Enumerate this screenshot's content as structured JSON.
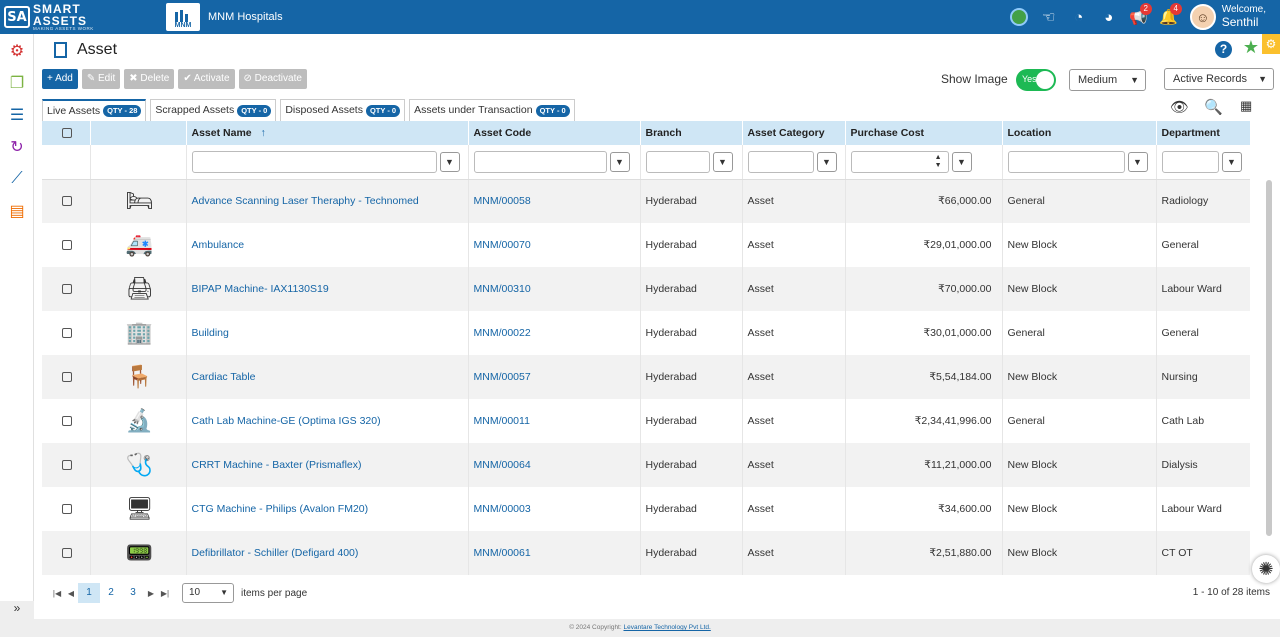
{
  "brand": {
    "logo_mark": "SA",
    "line1": "SMART",
    "line2": "ASSETS",
    "tagline": "MAKING ASSETS WORK",
    "client_logo": "MNM",
    "client_name": "MNM Hospitals"
  },
  "topbar": {
    "icons": [
      "globe-icon",
      "hand-icon",
      "pie-icon",
      "dashboard-icon",
      "megaphone-icon",
      "bell-icon"
    ],
    "megaphone_badge": "2",
    "bell_badge": "4",
    "welcome": "Welcome,",
    "user": "Senthil"
  },
  "page": {
    "title": "Asset"
  },
  "toolbar": {
    "add": "+ Add",
    "edit": "✎ Edit",
    "delete": "✖ Delete",
    "activate": "✔ Activate",
    "deactivate": "⊘ Deactivate"
  },
  "show_image": {
    "label": "Show Image",
    "toggle": "Yes"
  },
  "size_select": "Medium",
  "records_select": "Active Records",
  "tabs": [
    {
      "label": "Live Assets",
      "qty": "QTY - 28"
    },
    {
      "label": "Scrapped Assets",
      "qty": "QTY - 0"
    },
    {
      "label": "Disposed Assets",
      "qty": "QTY - 0"
    },
    {
      "label": "Assets under Transaction",
      "qty": "QTY - 0"
    }
  ],
  "columns": {
    "name": "Asset Name",
    "code": "Asset Code",
    "branch": "Branch",
    "category": "Asset Category",
    "cost": "Purchase Cost",
    "location": "Location",
    "department": "Department",
    "sort": "↑"
  },
  "rows": [
    {
      "name": "Advance Scanning Laser Theraphy - Technomed",
      "code": "MNM/00058",
      "branch": "Hyderabad",
      "category": "Asset",
      "cost": "₹66,000.00",
      "location": "General",
      "department": "Radiology"
    },
    {
      "name": "Ambulance",
      "code": "MNM/00070",
      "branch": "Hyderabad",
      "category": "Asset",
      "cost": "₹29,01,000.00",
      "location": "New Block",
      "department": "General"
    },
    {
      "name": "BIPAP Machine- IAX1130S19",
      "code": "MNM/00310",
      "branch": "Hyderabad",
      "category": "Asset",
      "cost": "₹70,000.00",
      "location": "New Block",
      "department": "Labour Ward"
    },
    {
      "name": "Building",
      "code": "MNM/00022",
      "branch": "Hyderabad",
      "category": "Asset",
      "cost": "₹30,01,000.00",
      "location": "General",
      "department": "General"
    },
    {
      "name": "Cardiac Table",
      "code": "MNM/00057",
      "branch": "Hyderabad",
      "category": "Asset",
      "cost": "₹5,54,184.00",
      "location": "New Block",
      "department": "Nursing"
    },
    {
      "name": "Cath Lab Machine-GE (Optima IGS 320)",
      "code": "MNM/00011",
      "branch": "Hyderabad",
      "category": "Asset",
      "cost": "₹2,34,41,996.00",
      "location": "General",
      "department": "Cath Lab"
    },
    {
      "name": "CRRT Machine - Baxter (Prismaflex)",
      "code": "MNM/00064",
      "branch": "Hyderabad",
      "category": "Asset",
      "cost": "₹11,21,000.00",
      "location": "New Block",
      "department": "Dialysis"
    },
    {
      "name": "CTG Machine - Philips (Avalon FM20)",
      "code": "MNM/00003",
      "branch": "Hyderabad",
      "category": "Asset",
      "cost": "₹34,600.00",
      "location": "New Block",
      "department": "Labour Ward"
    },
    {
      "name": "Defibrillator - Schiller (Defigard 400)",
      "code": "MNM/00061",
      "branch": "Hyderabad",
      "category": "Asset",
      "cost": "₹2,51,880.00",
      "location": "New Block",
      "department": "CT OT"
    }
  ],
  "pager": {
    "pages": [
      "1",
      "2",
      "3"
    ],
    "page_size": "10",
    "items_per_page": "items per page",
    "info": "1 - 10 of 28 items"
  },
  "footer": {
    "text": "© 2024 Copyright: ",
    "company": "Levantare Technology Pvt Ltd."
  },
  "colors": {
    "primary": "#1565a6",
    "toggle": "#1db954",
    "header_row": "#cfe6f5"
  }
}
